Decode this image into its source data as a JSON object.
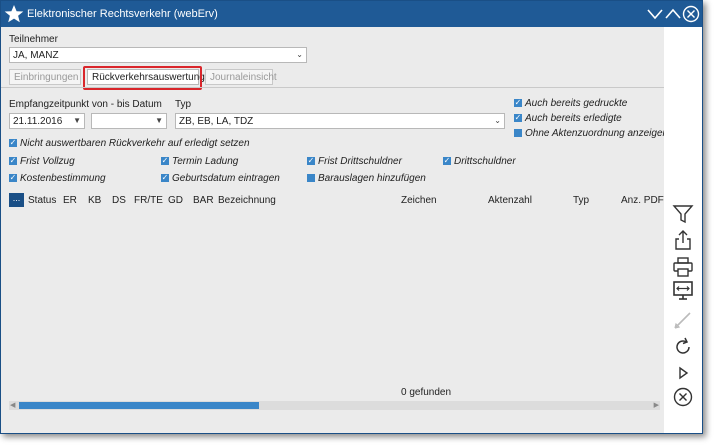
{
  "window": {
    "title": "Elektronischer Rechtsverkehr (webErv)"
  },
  "teilnehmer": {
    "label": "Teilnehmer",
    "value": "JA, MANZ"
  },
  "tabs": [
    {
      "label": "Einbringungen"
    },
    {
      "label": "Rückverkehrsauswertung"
    },
    {
      "label": "Journaleinsicht"
    }
  ],
  "filter": {
    "date_label": "Empfangzeitpunkt von - bis Datum",
    "date_from": "21.11.2016",
    "date_to": "",
    "typ_label": "Typ",
    "typ_value": "ZB, EB, LA, TDZ",
    "right_checks": [
      {
        "label": "Auch bereits gedruckte",
        "checked": true
      },
      {
        "label": "Auch bereits erledigte",
        "checked": true
      },
      {
        "label": "Ohne Aktenzuordnung anzeigen",
        "checked": false
      }
    ],
    "not_evaluable": {
      "label": "Nicht auswertbaren Rückverkehr auf erledigt setzen",
      "checked": true
    }
  },
  "options": [
    {
      "label": "Frist Vollzug",
      "checked": true
    },
    {
      "label": "Termin Ladung",
      "checked": true
    },
    {
      "label": "Frist Drittschuldner",
      "checked": true
    },
    {
      "label": "Drittschuldner",
      "checked": true
    },
    {
      "label": "Kostenbestimmung",
      "checked": true
    },
    {
      "label": "Geburtsdatum eintragen",
      "checked": true
    },
    {
      "label": "Barauslagen hinzufügen",
      "checked": false
    }
  ],
  "table": {
    "menu_label": "...",
    "columns": [
      "Status",
      "ER",
      "KB",
      "DS",
      "FR/TE",
      "GD",
      "BAR",
      "Bezeichnung",
      "Zeichen",
      "Aktenzahl",
      "Typ",
      "Anz. PDF"
    ]
  },
  "result_count": "0 gefunden",
  "icons": {
    "logo": "star-icon",
    "minimize": "chevron-down-icon",
    "maximize": "chevron-up-icon",
    "close": "close-circle-icon",
    "filter": "filter-icon",
    "export": "export-icon",
    "print": "printer-icon",
    "display": "monitor-icon",
    "edit": "pencil-icon",
    "refresh": "refresh-icon",
    "play": "play-icon",
    "cancel": "cancel-circle-icon"
  },
  "colors": {
    "titlebar": "#1f5a96",
    "accent": "#3a86c8",
    "highlight": "#d9262b"
  }
}
